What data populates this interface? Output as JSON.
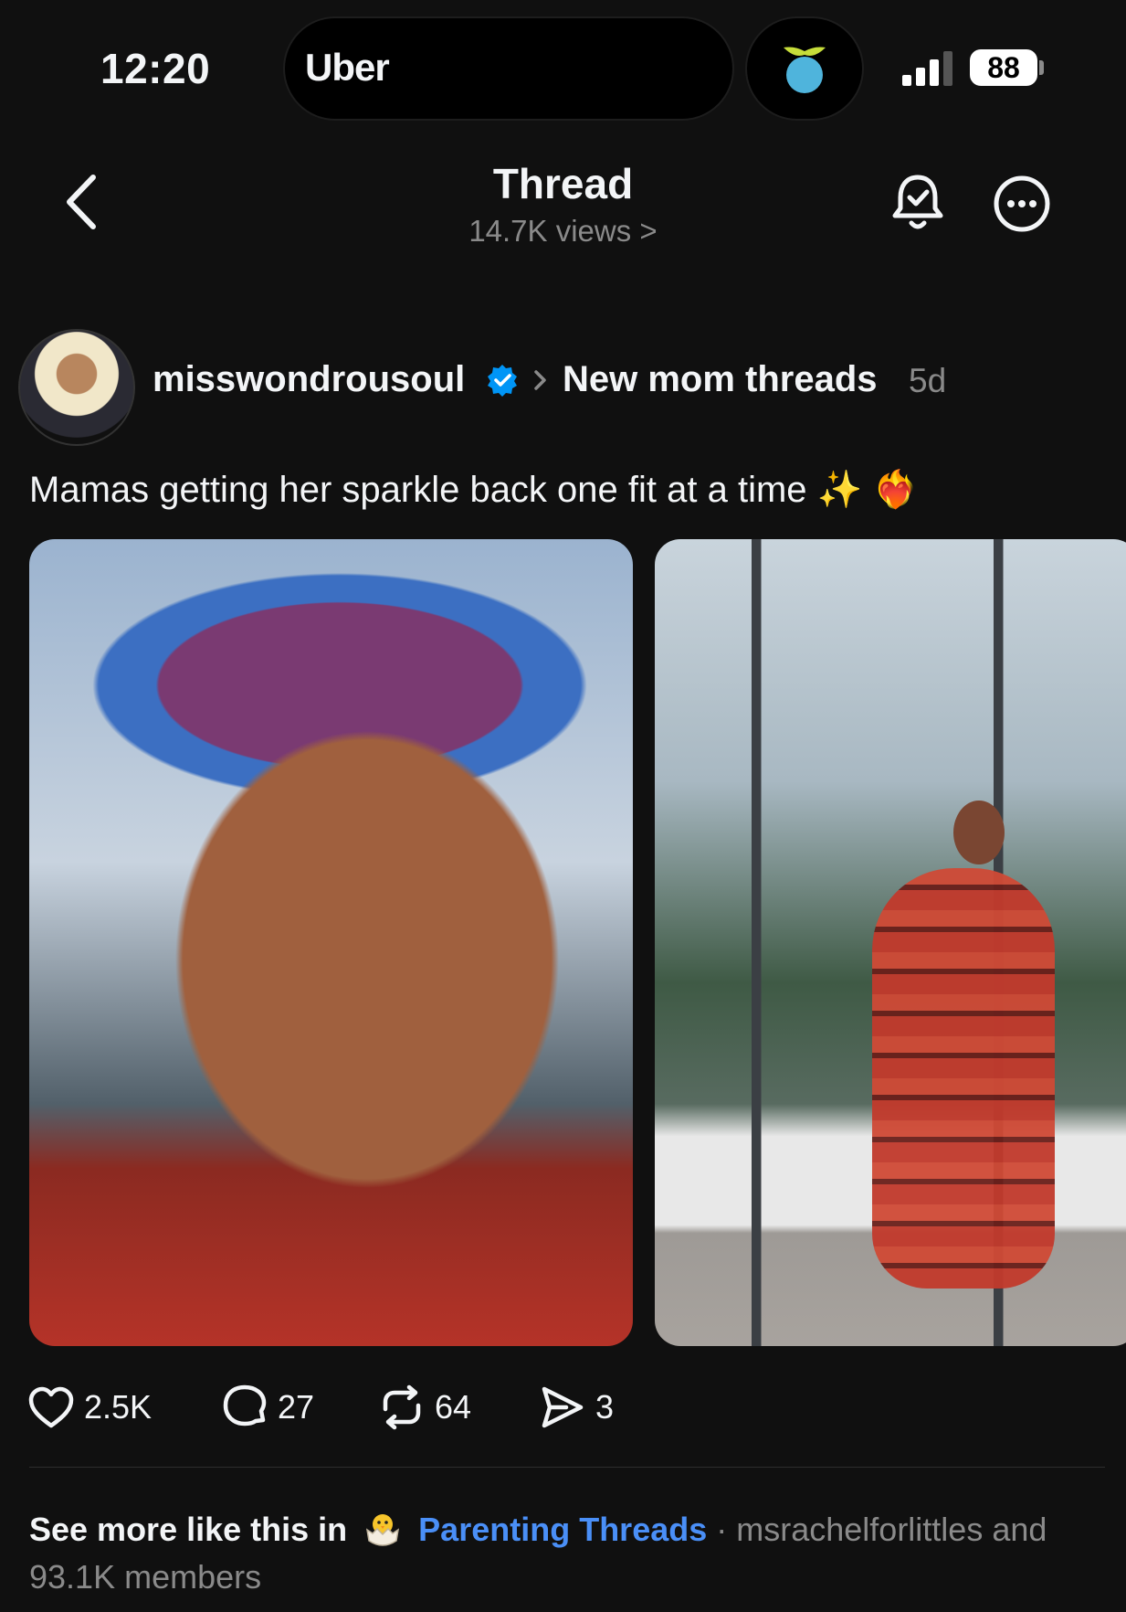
{
  "status_bar": {
    "time": "12:20",
    "live_activity_app": "Uber",
    "battery": "88",
    "icons": [
      "signal-icon",
      "battery-icon",
      "app-logo-icon"
    ]
  },
  "header": {
    "title": "Thread",
    "views": "14.7K views >",
    "icons": [
      "back-chevron-icon",
      "notification-bell-icon",
      "more-options-icon"
    ]
  },
  "post": {
    "username": "misswondrousoul",
    "verified": true,
    "community": "New mom threads",
    "age": "5d",
    "text": "Mamas getting her sparkle back one fit at a time ✨ ❤️‍🔥",
    "images": 2,
    "actions": {
      "likes": "2.5K",
      "replies": "27",
      "reposts": "64",
      "shares": "3"
    }
  },
  "suggestion": {
    "lead": "See more like this in",
    "community": "Parenting Threads",
    "tail": "· msrachelforlittles and 93.1K members"
  },
  "colors": {
    "background": "#101010",
    "text": "#f3f5f7",
    "secondary": "#8a8a8a",
    "link": "#4a8ff7",
    "verified": "#0095f6"
  }
}
